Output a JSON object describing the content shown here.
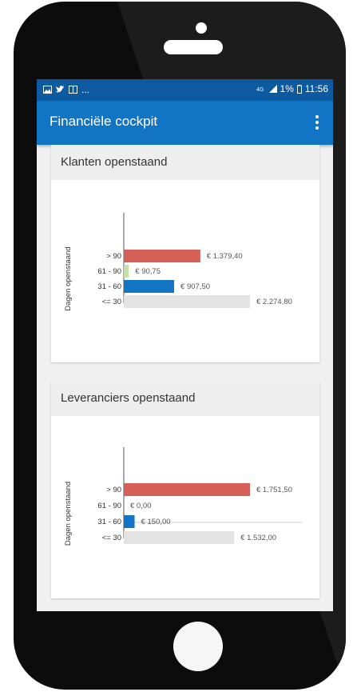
{
  "status_bar": {
    "indicators": "...",
    "battery": "1%",
    "time": "11:56"
  },
  "app_bar": {
    "title": "Financiële cockpit"
  },
  "colors": {
    "status_bar": "#0d5aa0",
    "app_bar": "#1174c4",
    "red": "#d55e56",
    "green": "#c5e0a5",
    "blue": "#1174c4",
    "grey": "#e3e3e3"
  },
  "cards": [
    {
      "title": "Klanten openstaand"
    },
    {
      "title": "Leveranciers openstaand"
    }
  ],
  "chart_data": [
    {
      "type": "bar",
      "orientation": "horizontal",
      "ylabel": "Dagen openstaand",
      "categories": [
        "> 90",
        "61 - 90",
        "31 - 60",
        "<= 30"
      ],
      "values": [
        1379.4,
        90.75,
        907.5,
        2274.8
      ],
      "value_labels": [
        "€ 1.379,40",
        "€ 90,75",
        "€ 907,50",
        "€ 2.274,80"
      ],
      "bar_colors": [
        "#d55e56",
        "#c5e0a5",
        "#1174c4",
        "#e3e3e3"
      ],
      "xlim": [
        0,
        2274.8
      ]
    },
    {
      "type": "bar",
      "orientation": "horizontal",
      "ylabel": "Dagen openstaand",
      "categories": [
        "> 90",
        "61 - 90",
        "31 - 60",
        "<= 30"
      ],
      "values": [
        1751.5,
        0.0,
        150.0,
        1532.0
      ],
      "value_labels": [
        "€ 1.751,50",
        "€ 0,00",
        "€ 150,00",
        "€ 1.532,00"
      ],
      "bar_colors": [
        "#d55e56",
        "#c5e0a5",
        "#1174c4",
        "#e3e3e3"
      ],
      "xlim": [
        0,
        1751.5
      ]
    }
  ]
}
